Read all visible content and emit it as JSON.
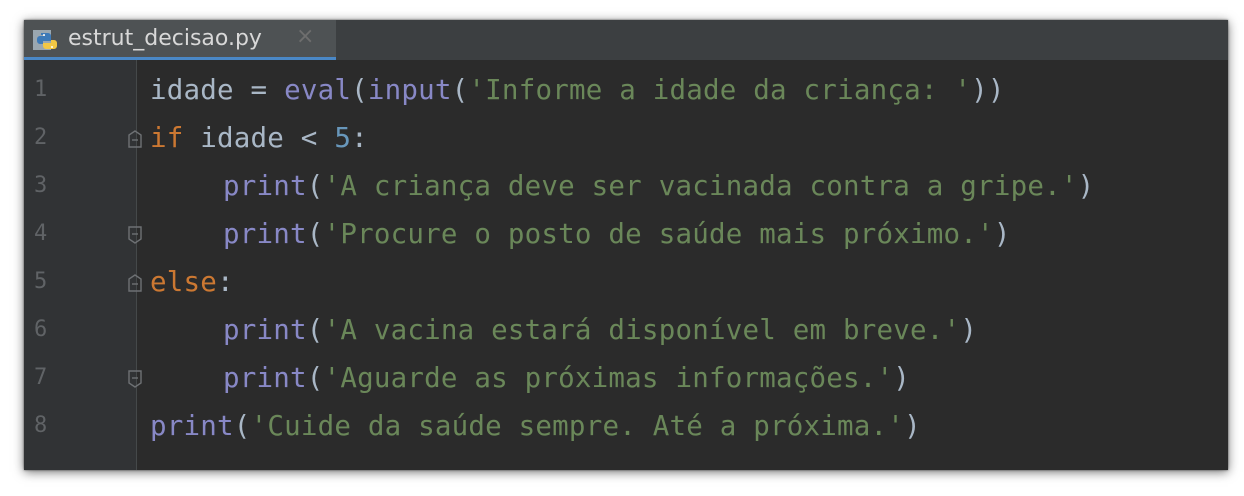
{
  "tab": {
    "file_name": "estrut_decisao.py",
    "close_glyph": "×",
    "icon": "python-file-icon"
  },
  "colors": {
    "background": "#2b2b2b",
    "gutter": "#313335",
    "keyword": "#cc7832",
    "builtin": "#8888c6",
    "string": "#6a8759",
    "number": "#6897bb",
    "identifier": "#a9b7c6",
    "line_number": "#606366"
  },
  "lines": [
    {
      "number": "1",
      "t1": "idade = ",
      "t2": "eval",
      "t3": "(",
      "t4": "input",
      "t5": "(",
      "t6": "'Informe a idade da criança: '",
      "t7": "))"
    },
    {
      "number": "2",
      "t1": "if",
      "t2": " idade < ",
      "t3": "5",
      "t4": ":"
    },
    {
      "number": "3",
      "t1": "print",
      "t2": "(",
      "t3": "'A criança deve ser vacinada contra a gripe.'",
      "t4": ")"
    },
    {
      "number": "4",
      "t1": "print",
      "t2": "(",
      "t3": "'Procure o posto de saúde mais próximo.'",
      "t4": ")"
    },
    {
      "number": "5",
      "t1": "else",
      "t2": ":"
    },
    {
      "number": "6",
      "t1": "print",
      "t2": "(",
      "t3": "'A vacina estará disponível em breve.'",
      "t4": ")"
    },
    {
      "number": "7",
      "t1": "print",
      "t2": "(",
      "t3": "'Aguarde as próximas informações.'",
      "t4": ")"
    },
    {
      "number": "8",
      "t1": "print",
      "t2": "(",
      "t3": "'Cuide da saúde sempre. Até a próxima.'",
      "t4": ")"
    }
  ]
}
